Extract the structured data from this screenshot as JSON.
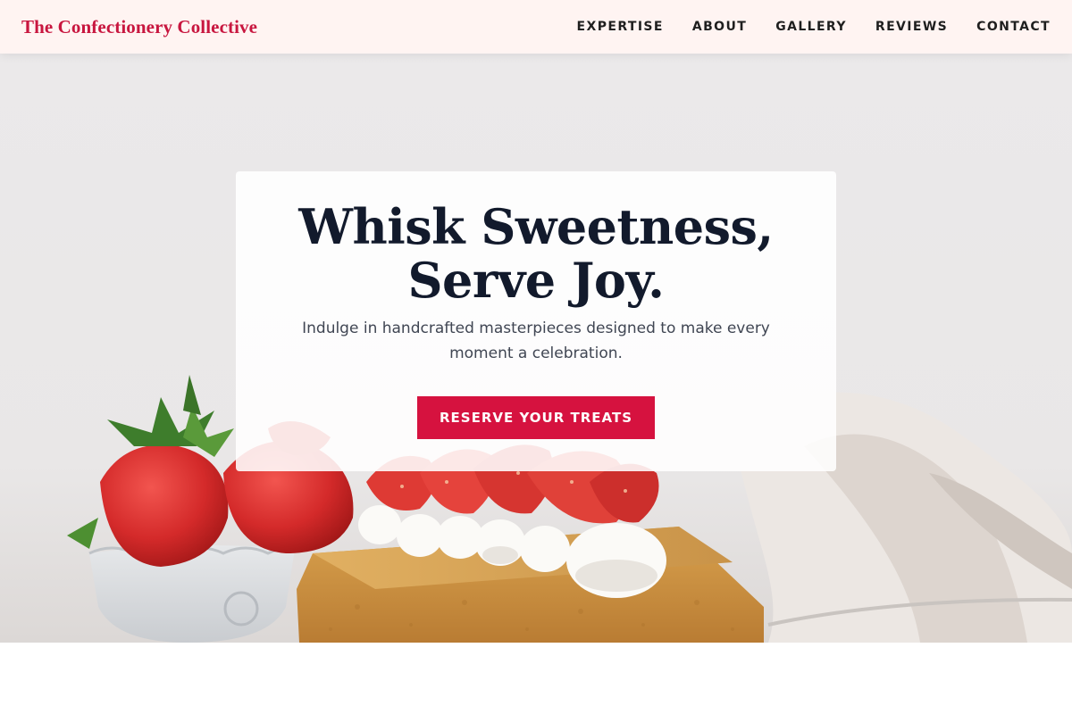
{
  "brand": {
    "name": "The Confectionery Collective",
    "color": "#c8163f"
  },
  "nav": {
    "items": [
      {
        "label": "EXPERTISE"
      },
      {
        "label": "ABOUT"
      },
      {
        "label": "GALLERY"
      },
      {
        "label": "REVIEWS"
      },
      {
        "label": "CONTACT"
      }
    ]
  },
  "hero": {
    "title": "Whisk Sweetness, Serve Joy.",
    "subtitle": "Indulge in handcrafted masterpieces designed to make every moment a celebration.",
    "cta_label": "RESERVE YOUR TREATS",
    "cta_color": "#d6123f",
    "image": "strawberry-cake-photo"
  }
}
